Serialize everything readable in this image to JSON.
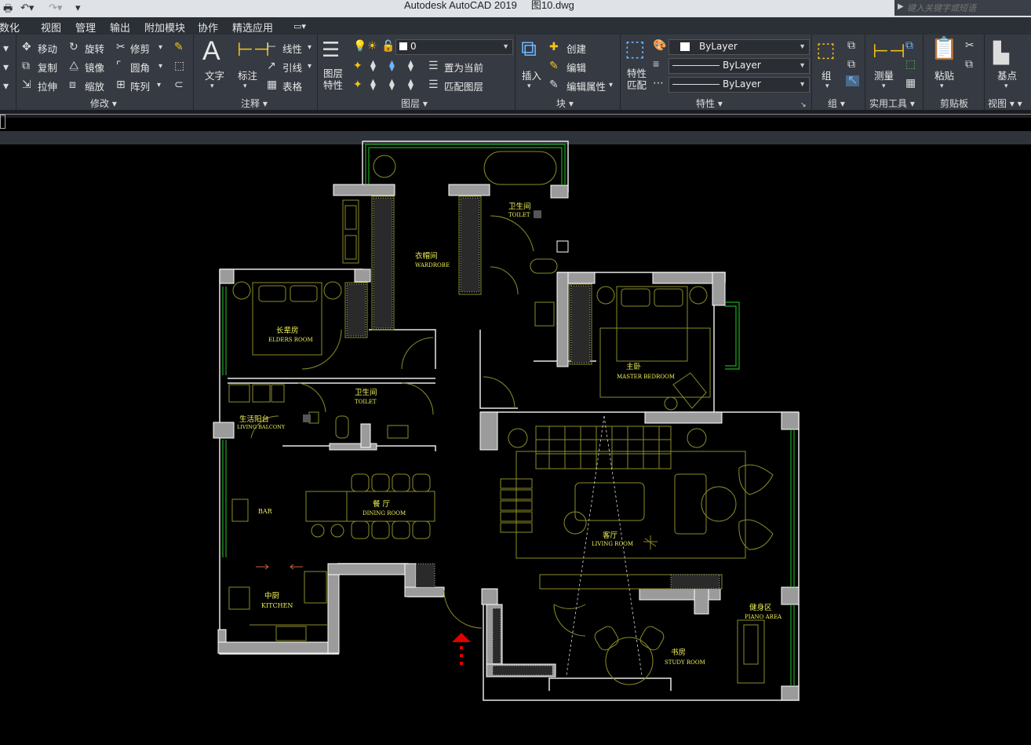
{
  "app": {
    "title": "Autodesk AutoCAD 2019",
    "document": "图10.dwg",
    "search_placeholder": "键入关键字或短语"
  },
  "menu": [
    "参数化",
    "视图",
    "管理",
    "输出",
    "附加模块",
    "协作",
    "精选应用"
  ],
  "ribbon": {
    "modify": {
      "buttons": [
        "移动",
        "旋转",
        "修剪",
        "复制",
        "镜像",
        "圆角",
        "拉伸",
        "缩放",
        "阵列"
      ],
      "title": "修改"
    },
    "annotation": {
      "text_label": "文字",
      "dimension_label": "标注",
      "linear": "线性",
      "leader": "引线",
      "table": "表格",
      "title": "注释"
    },
    "layers": {
      "props_label": "图层\n特性",
      "props_line1": "图层",
      "props_line2": "特性",
      "current_layer": "0",
      "set_current": "置为当前",
      "match_layer": "匹配图层",
      "title": "图层"
    },
    "block": {
      "insert": "插入",
      "create": "创建",
      "edit": "编辑",
      "edit_attr": "编辑属性",
      "title": "块"
    },
    "properties": {
      "match_line1": "特性",
      "match_line2": "匹配",
      "color": "ByLayer",
      "linetype": "ByLayer",
      "lineweight": "ByLayer",
      "title": "特性"
    },
    "group": {
      "label": "组",
      "title": "组"
    },
    "utilities": {
      "measure": "测量",
      "title": "实用工具"
    },
    "clipboard": {
      "paste": "粘贴",
      "title": "剪贴板"
    },
    "view": {
      "base": "基点",
      "title": "视图"
    }
  },
  "colors": {
    "wall_fill": "#9b9b9b",
    "wall_line": "#ffffff",
    "furniture": "#8c8c28",
    "room_label": "#f0f05a",
    "window": "#22a822",
    "entry_arrow": "#e00000"
  },
  "rooms": {
    "wardrobe": {
      "cn": "衣帽间",
      "en": "WARDROBE"
    },
    "toilet_top": {
      "cn": "卫生间",
      "en": "TOILET"
    },
    "elders_room": {
      "cn": "长辈房",
      "en": "ELDERS ROOM"
    },
    "toilet_mid": {
      "cn": "卫生间",
      "en": "TOILET"
    },
    "master_bedroom": {
      "cn": "主卧",
      "en": "MASTER BEDROOM"
    },
    "living_balcony": {
      "cn": "生活阳台",
      "en": "LIVING BALCONY"
    },
    "bar": {
      "en": "BAR"
    },
    "dining_room": {
      "cn": "餐  厅",
      "en": "DINING ROOM"
    },
    "living_room": {
      "cn": "客厅",
      "en": "LIVING ROOM"
    },
    "kitchen": {
      "cn": "中厨",
      "en": "KITCHEN"
    },
    "piano_area": {
      "cn": "健身区",
      "en": "PIANO AREA"
    },
    "study_room": {
      "cn": "书房",
      "en": "STUDY ROOM"
    }
  }
}
